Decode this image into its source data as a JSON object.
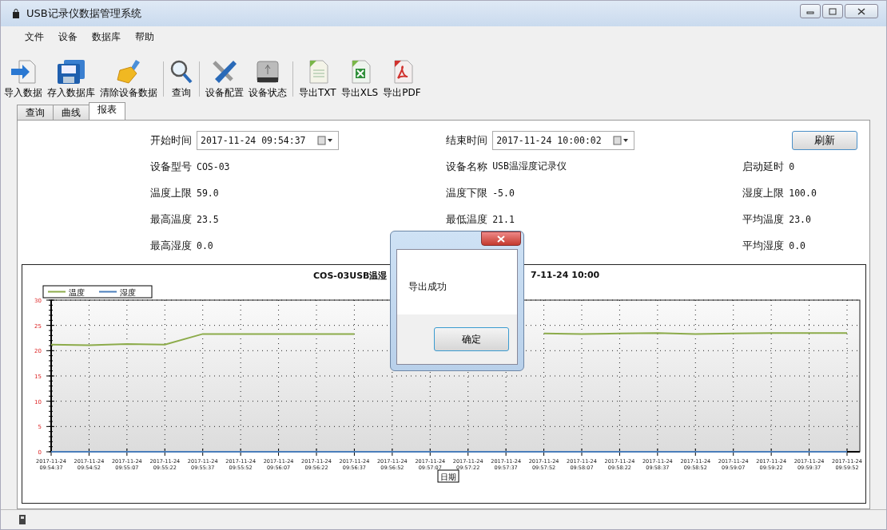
{
  "window": {
    "title": "USB记录仪数据管理系统"
  },
  "menu": [
    "文件",
    "设备",
    "数据库",
    "帮助"
  ],
  "toolbar_groups": [
    [
      {
        "label": "导入数据",
        "kind": "import"
      },
      {
        "label": "存入数据库",
        "kind": "save"
      },
      {
        "label": "清除设备数据",
        "kind": "clear"
      }
    ],
    [
      {
        "label": "查询",
        "kind": "search"
      }
    ],
    [
      {
        "label": "设备配置",
        "kind": "tools"
      },
      {
        "label": "设备状态",
        "kind": "drive"
      }
    ],
    [
      {
        "label": "导出TXT",
        "kind": "txt"
      },
      {
        "label": "导出XLS",
        "kind": "xls"
      },
      {
        "label": "导出PDF",
        "kind": "pdf"
      }
    ]
  ],
  "tabs": [
    {
      "label": "查询",
      "selected": false
    },
    {
      "label": "曲线",
      "selected": false
    },
    {
      "label": "报表",
      "selected": true
    }
  ],
  "start_time": {
    "label": "开始时间",
    "value": "2017-11-24 09:54:37"
  },
  "end_time": {
    "label": "结束时间",
    "value": "2017-11-24 10:00:02"
  },
  "refresh_button": "刷新",
  "field_columns": [
    [
      {
        "label": "设备型号",
        "value": "COS-03"
      },
      {
        "label": "温度上限",
        "value": "59.0"
      },
      {
        "label": "最高温度",
        "value": "23.5"
      },
      {
        "label": "最高湿度",
        "value": "0.0"
      }
    ],
    [
      {
        "label": "设备名称",
        "value": "USB温湿度记录仪"
      },
      {
        "label": "温度下限",
        "value": "-5.0"
      },
      {
        "label": "最低温度",
        "value": "21.1"
      }
    ],
    [
      {
        "label": "启动延时",
        "value": "0"
      },
      {
        "label": "湿度上限",
        "value": "100.0"
      },
      {
        "label": "平均温度",
        "value": "23.0"
      },
      {
        "label": "平均湿度",
        "value": "0.0"
      }
    ]
  ],
  "chart": {
    "title_parts": [
      "COS-03USB温湿",
      "7-11-24 10:00"
    ],
    "chart_data": {
      "type": "line",
      "xlabel": "日期",
      "grid": true,
      "legend": "top-left",
      "categories": [
        "2017-11-24 09:54:37",
        "2017-11-24 09:54:52",
        "2017-11-24 09:55:07",
        "2017-11-24 09:55:22",
        "2017-11-24 09:55:37",
        "2017-11-24 09:55:52",
        "2017-11-24 09:56:07",
        "2017-11-24 09:56:22",
        "2017-11-24 09:56:37",
        "2017-11-24 09:56:52",
        "2017-11-24 09:57:07",
        "2017-11-24 09:57:22",
        "2017-11-24 09:57:37",
        "2017-11-24 09:57:52",
        "2017-11-24 09:58:07",
        "2017-11-24 09:58:22",
        "2017-11-24 09:58:37",
        "2017-11-24 09:58:52",
        "2017-11-24 09:59:07",
        "2017-11-24 09:59:22",
        "2017-11-24 09:59:37",
        "2017-11-24 09:59:52"
      ],
      "series": [
        {
          "name": "温度",
          "color": "#8cab4a",
          "values": [
            21.2,
            21.1,
            21.3,
            21.2,
            23.3,
            23.3,
            23.3,
            23.3,
            23.3,
            null,
            null,
            null,
            null,
            23.4,
            23.3,
            23.4,
            23.5,
            23.3,
            23.4,
            23.5,
            23.5,
            23.5
          ]
        },
        {
          "name": "湿度",
          "color": "#4a7ebb",
          "values": [
            0,
            0,
            0,
            0,
            0,
            0,
            0,
            0,
            0,
            0,
            0,
            0,
            0,
            0,
            0,
            0,
            0,
            0,
            0,
            0,
            0,
            0
          ]
        }
      ],
      "ylim": [
        0,
        30
      ],
      "yticks": [
        0,
        5,
        10,
        15,
        20,
        25,
        30
      ]
    }
  },
  "dialog": {
    "message": "导出成功",
    "button": "确定"
  }
}
